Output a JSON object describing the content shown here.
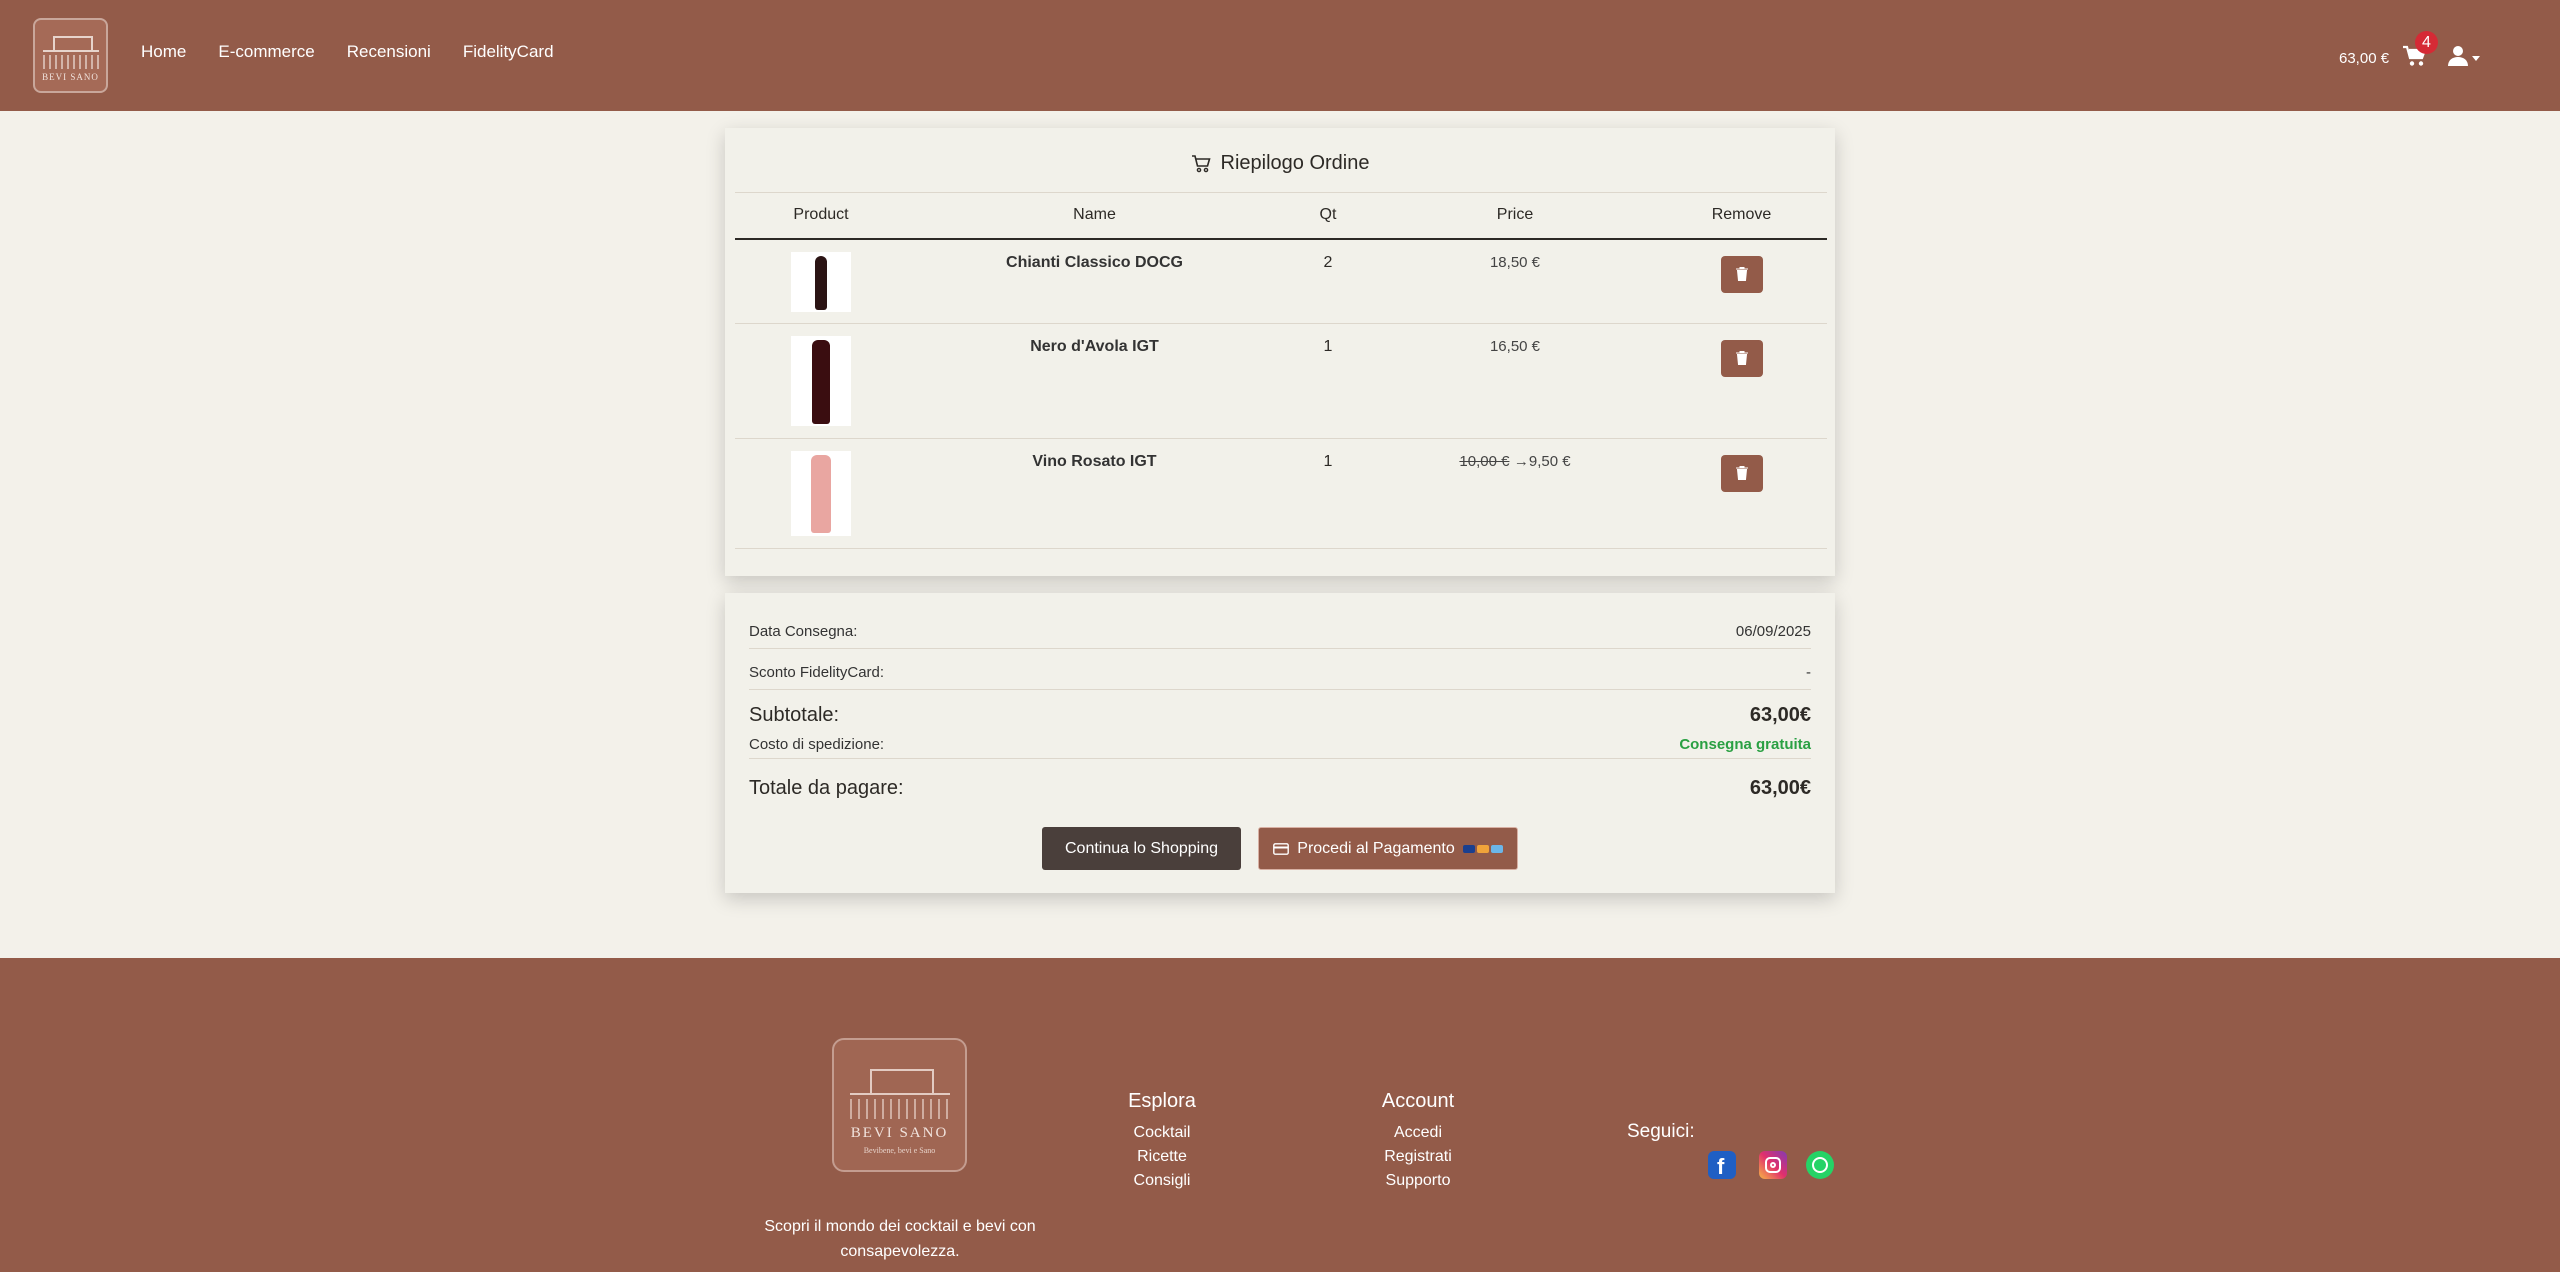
{
  "header": {
    "logo_text": "BEVI SANO",
    "nav": [
      "Home",
      "E-commerce",
      "Recensioni",
      "FidelityCard"
    ],
    "cart_total": "63,00 €",
    "cart_count": "4"
  },
  "order": {
    "title": "Riepilogo Ordine",
    "columns": [
      "Product",
      "Name",
      "Qt",
      "Price",
      "Remove"
    ],
    "items": [
      {
        "name": "Chianti Classico DOCG",
        "qty": "2",
        "price": "18,50 €",
        "old_price": "",
        "arrow": "",
        "bottle_color": "#2b1414"
      },
      {
        "name": "Nero d'Avola IGT",
        "qty": "1",
        "price": "16,50 €",
        "old_price": "",
        "arrow": "",
        "bottle_color": "#3a0d10"
      },
      {
        "name": "Vino Rosato IGT",
        "qty": "1",
        "price": "9,50 €",
        "old_price": "10,00 €",
        "arrow": "→",
        "bottle_color": "#e9a6a1"
      }
    ]
  },
  "summary": {
    "delivery_label": "Data Consegna:",
    "delivery_value": "06/09/2025",
    "discount_label": "Sconto FidelityCard:",
    "discount_value": "-",
    "subtotal_label": "Subtotale:",
    "subtotal_value": "63,00€",
    "shipping_label": "Costo di spedizione:",
    "shipping_value": "Consegna gratuita",
    "total_label": "Totale da pagare:",
    "total_value": "63,00€",
    "continue_label": "Continua lo Shopping",
    "pay_label": "Procedi al Pagamento"
  },
  "footer": {
    "logo_text": "BEVI SANO",
    "logo_sub": "Bevibene, bevi e Sano",
    "tagline": "Scopri il mondo dei cocktail e bevi con consapevolezza.",
    "esplora": {
      "title": "Esplora",
      "links": [
        "Cocktail",
        "Ricette",
        "Consigli"
      ]
    },
    "account": {
      "title": "Account",
      "links": [
        "Accedi",
        "Registrati",
        "Supporto"
      ]
    },
    "follow_label": "Seguici:"
  },
  "colors": {
    "brand": "#935b49",
    "background": "#f3f1ea",
    "success": "#2aa043",
    "badge": "#d52a35"
  }
}
